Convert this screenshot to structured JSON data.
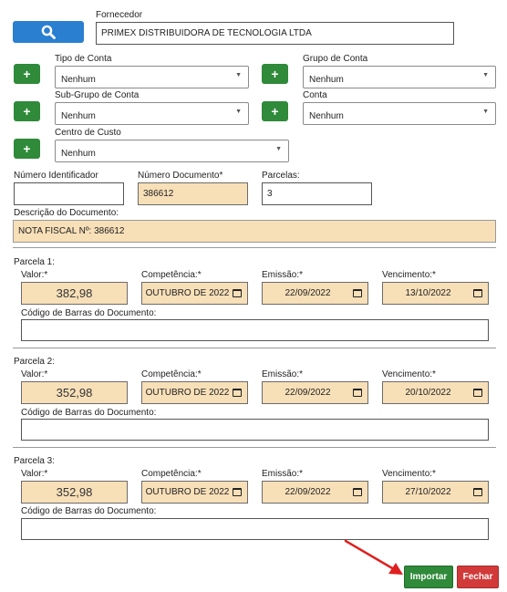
{
  "fornecedor": {
    "label": "Fornecedor",
    "value": "PRIMEX DISTRIBUIDORA DE TECNOLOGIA LTDA"
  },
  "tipo_conta": {
    "label": "Tipo de Conta",
    "value": "Nenhum"
  },
  "grupo_conta": {
    "label": "Grupo de Conta",
    "value": "Nenhum"
  },
  "subgrupo_conta": {
    "label": "Sub-Grupo de Conta",
    "value": "Nenhum"
  },
  "conta": {
    "label": "Conta",
    "value": "Nenhum"
  },
  "centro_custo": {
    "label": "Centro de Custo",
    "value": "Nenhum"
  },
  "plus_label": "+",
  "numero_identificador": {
    "label": "Número Identificador",
    "value": ""
  },
  "numero_documento": {
    "label": "Número Documento*",
    "value": "386612"
  },
  "parcelas": {
    "label": "Parcelas:",
    "value": "3"
  },
  "descricao": {
    "label": "Descrição do Documento:",
    "value": "NOTA FISCAL Nº: 386612"
  },
  "field_labels": {
    "valor": "Valor:*",
    "competencia": "Competência:*",
    "emissao": "Emissão:*",
    "vencimento": "Vencimento:*",
    "barcode": "Código de Barras do Documento:"
  },
  "installments": [
    {
      "title": "Parcela 1:",
      "valor": "382,98",
      "competencia": "OUTUBRO DE 2022",
      "emissao": "22/09/2022",
      "vencimento": "13/10/2022",
      "barcode": ""
    },
    {
      "title": "Parcela 2:",
      "valor": "352,98",
      "competencia": "OUTUBRO DE 2022",
      "emissao": "22/09/2022",
      "vencimento": "20/10/2022",
      "barcode": ""
    },
    {
      "title": "Parcela 3:",
      "valor": "352,98",
      "competencia": "OUTUBRO DE 2022",
      "emissao": "22/09/2022",
      "vencimento": "27/10/2022",
      "barcode": ""
    }
  ],
  "buttons": {
    "importar": "Importar",
    "fechar": "Fechar"
  },
  "colors": {
    "green": "#2f8a3a",
    "red": "#d23a3a",
    "blue": "#2a7fd0",
    "tan": "#f7dfb8",
    "arrow": "#e02020"
  }
}
